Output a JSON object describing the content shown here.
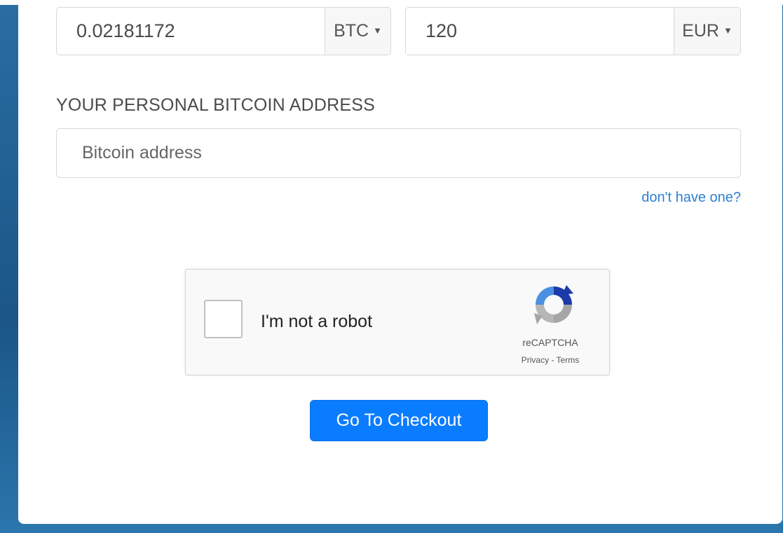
{
  "exchange": {
    "crypto_amount": "0.02181172",
    "crypto_currency": "BTC",
    "fiat_amount": "120",
    "fiat_currency": "EUR"
  },
  "address_section": {
    "label": "YOUR PERSONAL BITCOIN ADDRESS",
    "placeholder": "Bitcoin address",
    "help_link": "don't have one?"
  },
  "captcha": {
    "checkbox_label": "I'm not a robot",
    "brand": "reCAPTCHA",
    "terms": "Privacy - Terms"
  },
  "checkout_button": "Go To Checkout",
  "colors": {
    "accent": "#0a7cff",
    "link": "#2f7fd0",
    "background_border": "#1f5d8e"
  },
  "icons": {
    "dropdown": "caret-down-icon",
    "captcha_logo": "recaptcha-logo-icon"
  }
}
